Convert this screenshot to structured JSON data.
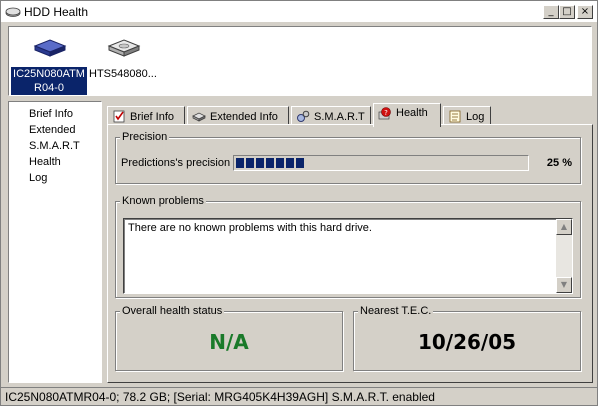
{
  "window": {
    "title": "HDD Health",
    "minimize": "_",
    "maximize": "□",
    "close": "×"
  },
  "drives": [
    {
      "label_line1": "IC25N080ATM",
      "label_line2": "R04-0",
      "selected": true
    },
    {
      "label_line1": "HTS548080...",
      "label_line2": "",
      "selected": false
    }
  ],
  "sidebar": {
    "items": [
      {
        "label": "Brief Info"
      },
      {
        "label": "Extended"
      },
      {
        "label": "S.M.A.R.T"
      },
      {
        "label": "Health"
      },
      {
        "label": "Log"
      }
    ]
  },
  "tabs": [
    {
      "label": "Brief Info",
      "icon": "checklist-icon"
    },
    {
      "label": "Extended Info",
      "icon": "drive-icon"
    },
    {
      "label": "S.M.A.R.T",
      "icon": "gears-icon"
    },
    {
      "label": "Health",
      "icon": "health-icon",
      "active": true
    },
    {
      "label": "Log",
      "icon": "log-icon"
    }
  ],
  "health": {
    "precision_title": "Precision",
    "precision_label": "Predictions's precision",
    "precision_value_text": "25 %",
    "precision_value": 0.25,
    "problems_title": "Known problems",
    "problems_text": "There are no known problems with this hard drive.",
    "overall_title": "Overall health status",
    "overall_value": "N/A",
    "overall_color": "#1a7a2a",
    "tec_title": "Nearest T.E.C.",
    "tec_value": "10/26/05"
  },
  "status": {
    "text": "IC25N080ATMR04-0;   78.2 GB;   [Serial: MRG405K4H39AGH]    S.M.A.R.T. enabled"
  },
  "colors": {
    "selection": "#0a246a",
    "progress": "#0a246a",
    "face": "#d4d0c8"
  }
}
